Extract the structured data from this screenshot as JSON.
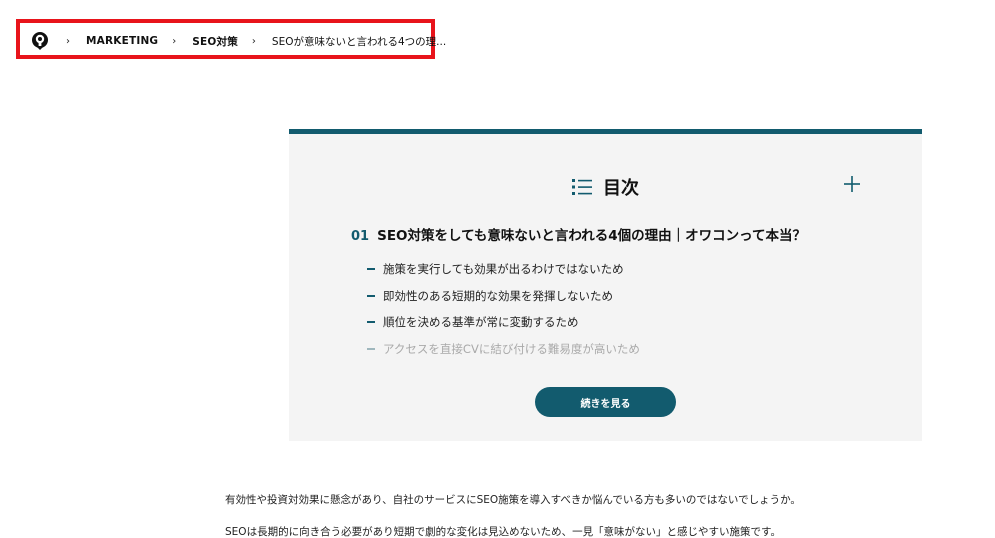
{
  "breadcrumb": {
    "home_icon": "home-logo-icon",
    "items": [
      {
        "label": "MARKETING"
      },
      {
        "label": "SEO対策"
      }
    ],
    "current": "SEOが意味ないと言われる4つの理..."
  },
  "toc": {
    "title": "目次",
    "expand_icon": "plus-icon",
    "list_icon": "list-icon",
    "heading": {
      "number": "01",
      "text": "SEO対策をしても意味ないと言われる4個の理由｜オワコンって本当？"
    },
    "items": [
      {
        "label": "施策を実行しても効果が出るわけではないため"
      },
      {
        "label": "即効性のある短期的な効果を発揮しないため"
      },
      {
        "label": "順位を決める基準が常に変動するため"
      },
      {
        "label": "アクセスを直接CVに結び付ける難易度が高いため"
      }
    ],
    "more_button": "続きを見る"
  },
  "article": {
    "paragraphs": [
      "有効性や投資対効果に懸念があり、自社のサービスにSEO施策を導入すべきか悩んでいる方も多いのではないでしょうか。",
      "SEOは長期的に向き合う必要があり短期で劇的な変化は見込めないため、一見「意味がない」と感じやすい施策です。"
    ]
  },
  "colors": {
    "accent": "#125b6e",
    "highlight": "#e8141b",
    "panel_bg": "#f4f4f4"
  }
}
